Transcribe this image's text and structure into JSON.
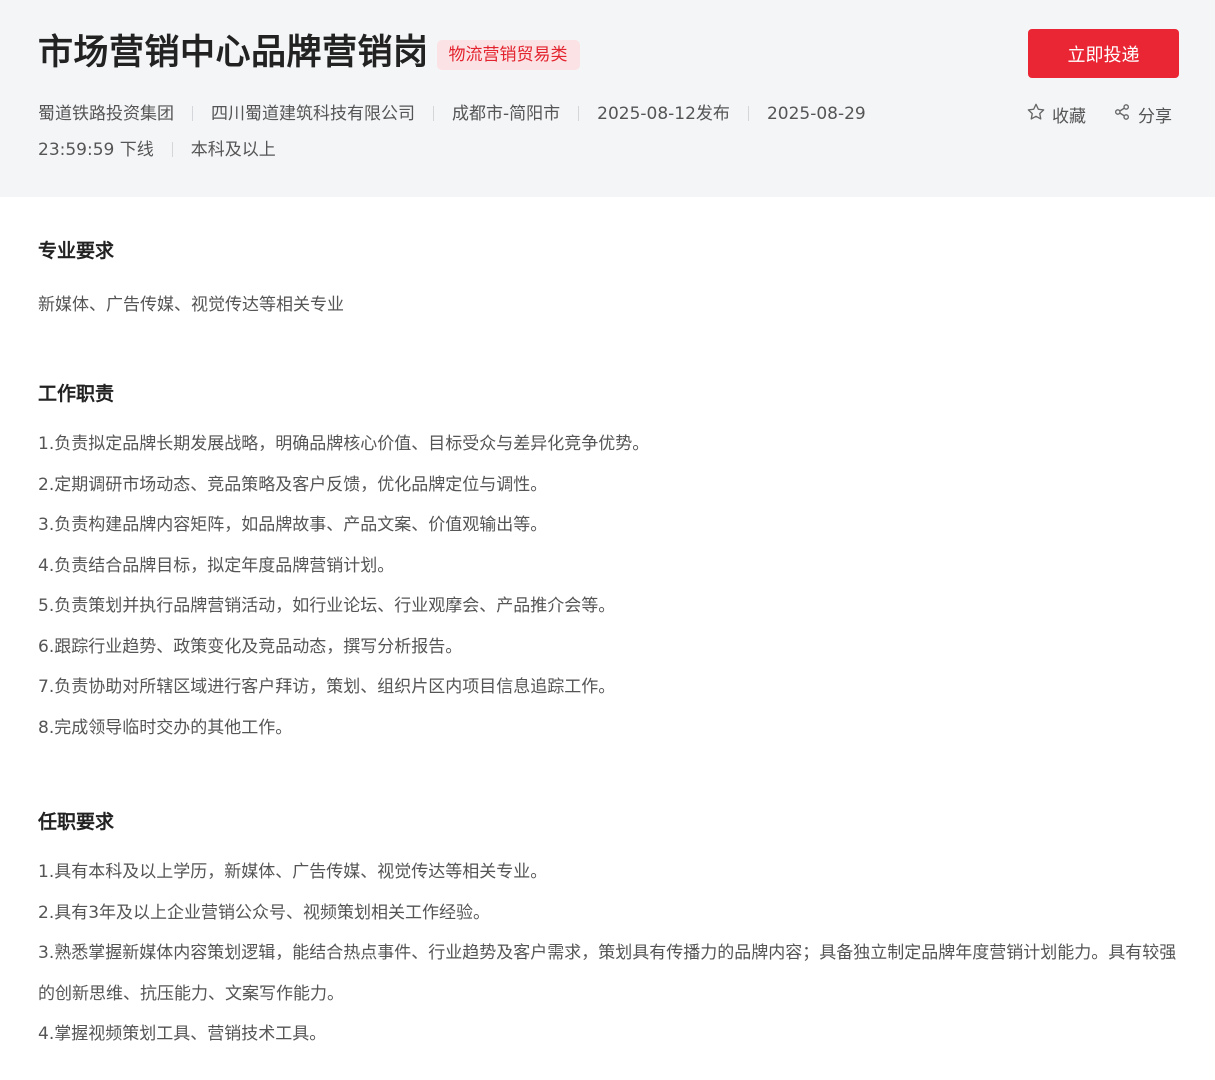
{
  "header": {
    "title": "市场营销中心品牌营销岗",
    "category": "物流营销贸易类",
    "apply_label": "立即投递",
    "meta": [
      "蜀道铁路投资集团",
      "四川蜀道建筑科技有限公司",
      "成都市-简阳市",
      "2025-08-12发布",
      "2025-08-29 23:59:59 下线",
      "本科及以上"
    ],
    "favorite_label": "收藏",
    "share_label": "分享"
  },
  "sections": {
    "major": {
      "title": "专业要求",
      "text": "新媒体、广告传媒、视觉传达等相关专业"
    },
    "duties": {
      "title": "工作职责",
      "items": [
        "1.负责拟定品牌长期发展战略，明确品牌核心价值、目标受众与差异化竞争优势。",
        "2.定期调研市场动态、竞品策略及客户反馈，优化品牌定位与调性。",
        "3.负责构建品牌内容矩阵，如品牌故事、产品文案、价值观输出等。",
        "4.负责结合品牌目标，拟定年度品牌营销计划。",
        "5.负责策划并执行品牌营销活动，如行业论坛、行业观摩会、产品推介会等。",
        "6.跟踪行业趋势、政策变化及竞品动态，撰写分析报告。",
        "7.负责协助对所辖区域进行客户拜访，策划、组织片区内项目信息追踪工作。",
        "8.完成领导临时交办的其他工作。"
      ]
    },
    "requirements": {
      "title": "任职要求",
      "items": [
        "1.具有本科及以上学历，新媒体、广告传媒、视觉传达等相关专业。",
        "2.具有3年及以上企业营销公众号、视频策划相关工作经验。",
        "3.熟悉掌握新媒体内容策划逻辑，能结合热点事件、行业趋势及客户需求，策划具有传播力的品牌内容；具备独立制定品牌年度营销计划能力。具有较强的创新思维、抗压能力、文案写作能力。",
        "4.掌握视频策划工具、营销技术工具。"
      ]
    }
  },
  "colors": {
    "accent": "#ea2635",
    "badge_bg": "#fbe3e5",
    "header_bg": "#f4f5f7"
  },
  "icons": {
    "favorite": "star-outline-icon",
    "share": "share-nodes-icon"
  }
}
